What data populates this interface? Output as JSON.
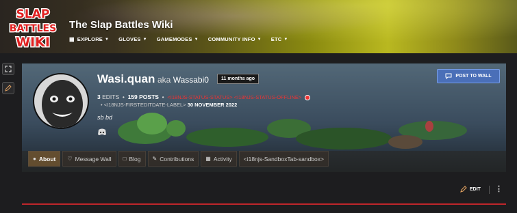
{
  "site": {
    "title": "The Slap Battles Wiki",
    "logo_text": [
      "SLAP",
      "BATTLES",
      "WIKI"
    ]
  },
  "nav": [
    {
      "label": "EXPLORE",
      "icon": "book-icon"
    },
    {
      "label": "GLOVES"
    },
    {
      "label": "GAMEMODES"
    },
    {
      "label": "COMMUNITY INFO"
    },
    {
      "label": "ETC"
    }
  ],
  "sidebar": {
    "expand_icon": "expand-icon",
    "edit_icon": "pencil-icon"
  },
  "profile": {
    "username": "Wasi.quan",
    "aka_label": "aka",
    "aka_name": "Wassabi0",
    "age_badge": "11 months ago",
    "post_button": "POST TO WALL",
    "edits_count": "3",
    "edits_label": "EDITS",
    "posts_count": "159",
    "posts_label": "POSTS",
    "status_text": "<I18NJS-STATUS-STATUS> <I18NJS-STATUS-OFFLINE>",
    "firstedit_label": "<I18NJS-FIRSTEDITDATE-LABEL>",
    "firstedit_date": "30 NOVEMBER 2022",
    "bio": "sb bd",
    "status_color": "#e33333"
  },
  "tabs": [
    {
      "label": "About",
      "icon": "user-icon",
      "active": true
    },
    {
      "label": "Message Wall",
      "icon": "heart-icon"
    },
    {
      "label": "Blog",
      "icon": "blog-icon"
    },
    {
      "label": "Contributions",
      "icon": "pencil-icon"
    },
    {
      "label": "Activity",
      "icon": "grid-icon"
    },
    {
      "label": "<i18njs-SandboxTab-sandbox>",
      "icon": ""
    }
  ],
  "actions": {
    "edit_label": "EDIT"
  },
  "colors": {
    "accent_red": "#c0262b",
    "post_button": "#4a6fb8"
  }
}
